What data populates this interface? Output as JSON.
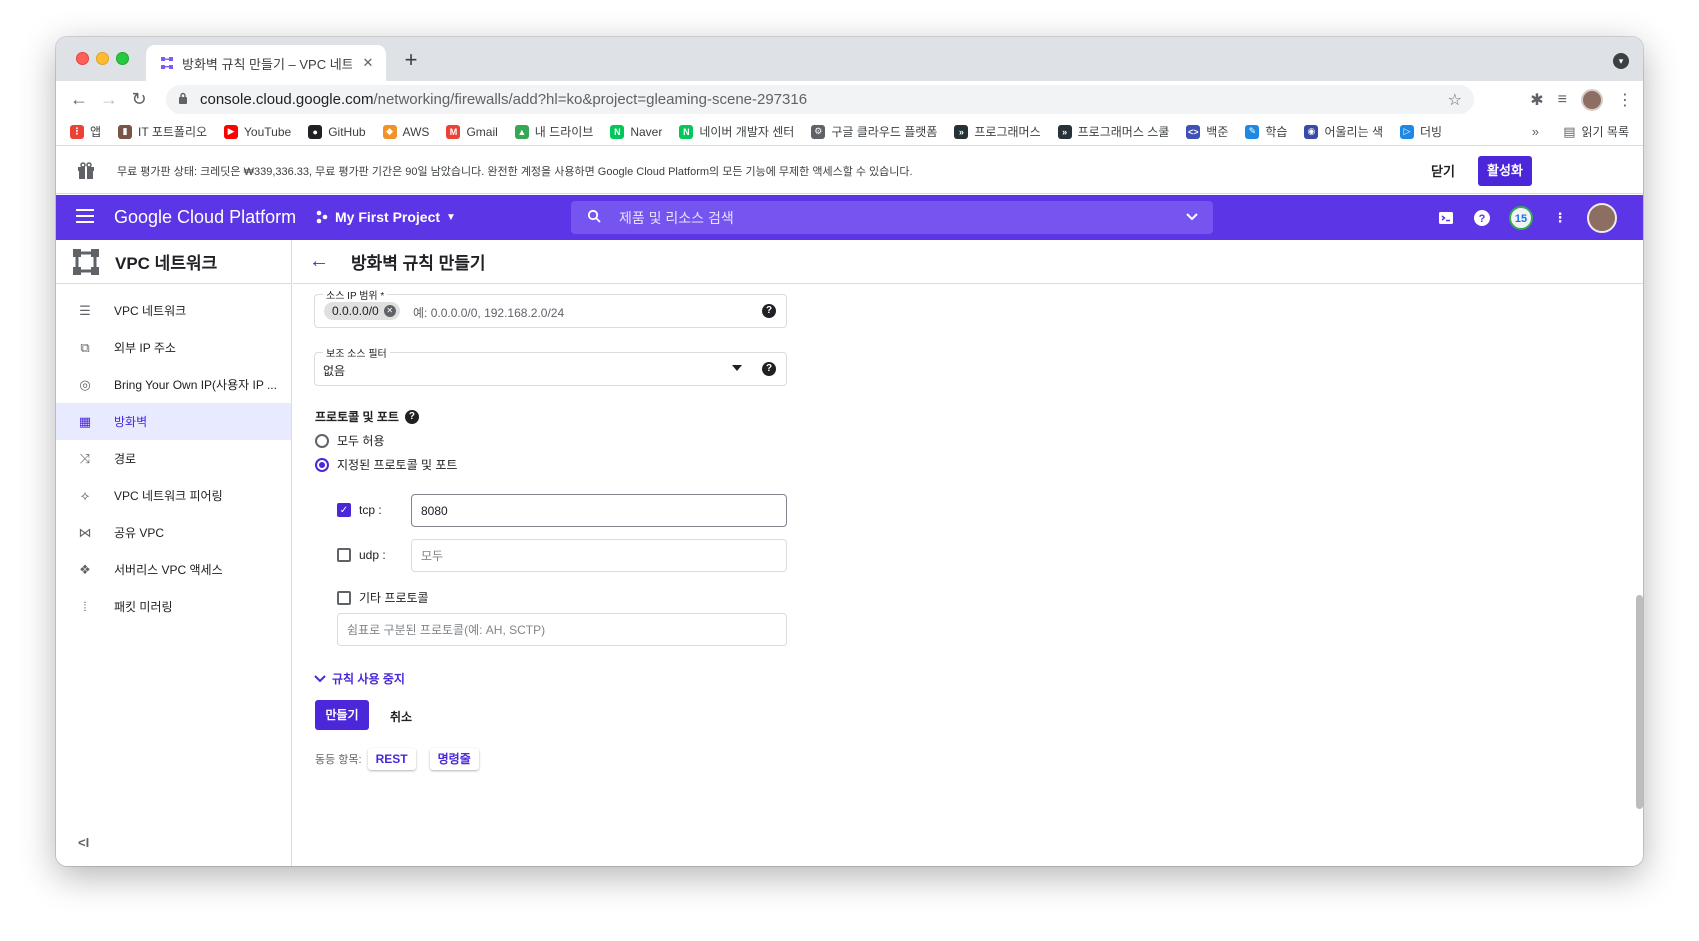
{
  "browser": {
    "tab_title": "방화벽 규칙 만들기 – VPC 네트워크",
    "url_host": "console.cloud.google.com",
    "url_path": "/networking/firewalls/add?hl=ko&project=gleaming-scene-297316"
  },
  "bookmarks": [
    {
      "label": "앱",
      "icon": "apps-grid-icon",
      "color": "#ea4335"
    },
    {
      "label": "IT 포트폴리오",
      "icon": "bottle-icon",
      "color": "#795548"
    },
    {
      "label": "YouTube",
      "icon": "youtube-icon",
      "color": "#ff0000"
    },
    {
      "label": "GitHub",
      "icon": "github-icon",
      "color": "#202124"
    },
    {
      "label": "AWS",
      "icon": "aws-cube-icon",
      "color": "#f0932b"
    },
    {
      "label": "Gmail",
      "icon": "gmail-icon",
      "color": "#ea4335"
    },
    {
      "label": "내 드라이브",
      "icon": "drive-icon",
      "color": "#34a853"
    },
    {
      "label": "Naver",
      "icon": "naver-icon",
      "color": "#03c75a"
    },
    {
      "label": "네이버 개발자 센터",
      "icon": "naver-icon",
      "color": "#03c75a"
    },
    {
      "label": "구글 클라우드 플랫폼",
      "icon": "cloud-gear-icon",
      "color": "#5f6368"
    },
    {
      "label": "프로그래머스",
      "icon": "programmers-icon",
      "color": "#263238"
    },
    {
      "label": "프로그래머스 스쿨",
      "icon": "programmers-icon",
      "color": "#263238"
    },
    {
      "label": "백준",
      "icon": "code-icon",
      "color": "#3f51b5"
    },
    {
      "label": "학습",
      "icon": "learning-icon",
      "color": "#1e88e5"
    },
    {
      "label": "어울리는 색",
      "icon": "palette-icon",
      "color": "#3949ab"
    },
    {
      "label": "더빙",
      "icon": "play-icon",
      "color": "#1e88e5"
    }
  ],
  "bookmarks_more": "»",
  "reading_list": "읽기 목록",
  "trial": {
    "text": "무료 평가판 상태: 크레딧은 ₩339,336.33, 무료 평가판 기간은 90일 남았습니다. 완전한 계정을 사용하면 Google Cloud Platform의 모든 기능에 무제한 액세스할 수 있습니다.",
    "close": "닫기",
    "activate": "활성화"
  },
  "header": {
    "brand": "Google Cloud Platform",
    "project": "My First Project",
    "search_placeholder": "제품 및 리소스 검색",
    "notification_count": "15"
  },
  "sidebar": {
    "title": "VPC 네트워크",
    "items": [
      {
        "label": "VPC 네트워크",
        "icon": "vpc-network-icon"
      },
      {
        "label": "외부 IP 주소",
        "icon": "external-ip-icon"
      },
      {
        "label": "Bring Your Own IP(사용자 IP ...",
        "icon": "globe-icon"
      },
      {
        "label": "방화벽",
        "icon": "firewall-icon",
        "active": true
      },
      {
        "label": "경로",
        "icon": "routes-icon"
      },
      {
        "label": "VPC 네트워크 피어링",
        "icon": "peering-icon"
      },
      {
        "label": "공유 VPC",
        "icon": "shared-vpc-icon"
      },
      {
        "label": "서버리스 VPC 액세스",
        "icon": "serverless-icon"
      },
      {
        "label": "패킷 미러링",
        "icon": "packet-mirroring-icon"
      }
    ],
    "collapse": "<I"
  },
  "page": {
    "title": "방화벽 규칙 만들기",
    "source_ip": {
      "label": "소스 IP 범위 *",
      "chip": "0.0.0.0/0",
      "placeholder": "예: 0.0.0.0/0, 192.168.2.0/24"
    },
    "secondary_filter": {
      "label": "보조 소스 필터",
      "value": "없음"
    },
    "protocols": {
      "title": "프로토콜 및 포트",
      "allow_all": "모두 허용",
      "specified": "지정된 프로토콜 및 포트",
      "selected": "specified",
      "tcp_label": "tcp :",
      "tcp_checked": true,
      "tcp_value": "8080",
      "udp_label": "udp :",
      "udp_checked": false,
      "udp_placeholder": "모두",
      "other_label": "기타 프로토콜",
      "other_checked": false,
      "other_placeholder": "쉼표로 구분된 프로토콜(예: AH, SCTP)"
    },
    "disable_rule": "규칙 사용 중지",
    "create": "만들기",
    "cancel": "취소",
    "equivalent": {
      "label": "동등 항목:",
      "rest": "REST",
      "command_line": "명령줄"
    }
  },
  "colors": {
    "brand": "#5b35e6",
    "accent": "#4b27d9",
    "active_bg": "#e8eaff"
  }
}
